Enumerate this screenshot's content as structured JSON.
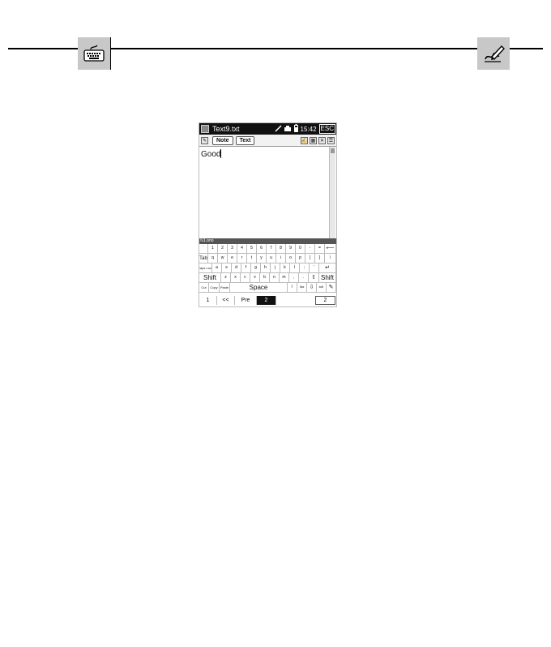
{
  "header": {
    "left_icon": "keyboard-icon",
    "right_icon": "pen-writing-icon"
  },
  "device": {
    "titlebar": {
      "title": "Text9.txt",
      "time": "15:42",
      "esc_label": "ESC",
      "icons": [
        "app-logo-icon",
        "pen-icon",
        "signal-icon",
        "battery-icon"
      ]
    },
    "toolbar": {
      "note_label": "Note",
      "text_label": "Text",
      "icons": [
        "edit-icon",
        "handwriting-icon",
        "keyboard-toggle-icon",
        "close-icon",
        "options-icon"
      ]
    },
    "editor": {
      "text": "Good"
    },
    "keyboard_bar_label": "ℕ1.ono",
    "keyboard": {
      "row1": [
        "`",
        "1",
        "2",
        "3",
        "4",
        "5",
        "6",
        "7",
        "8",
        "9",
        "0",
        "-",
        "=",
        "⟵"
      ],
      "row2": [
        "Tab",
        "q",
        "w",
        "e",
        "r",
        "t",
        "y",
        "u",
        "i",
        "o",
        "p",
        "[",
        "]",
        "\\"
      ],
      "row3": [
        "Caps Lock",
        "a",
        "s",
        "d",
        "f",
        "g",
        "h",
        "j",
        "k",
        "l",
        ";",
        "'",
        "↵"
      ],
      "row4": [
        "Shift",
        "z",
        "x",
        "c",
        "v",
        "b",
        "n",
        "m",
        ",",
        ".",
        "⇧",
        "Shift"
      ],
      "row5": [
        "Cut",
        "Copy",
        "Paste",
        "Space",
        "/",
        "⇦",
        "⇩",
        "⇨",
        "✎"
      ]
    },
    "pagebar": {
      "first": "1",
      "prev_fast": "<<",
      "prev": "Pre",
      "current": "2",
      "total": "2"
    }
  }
}
